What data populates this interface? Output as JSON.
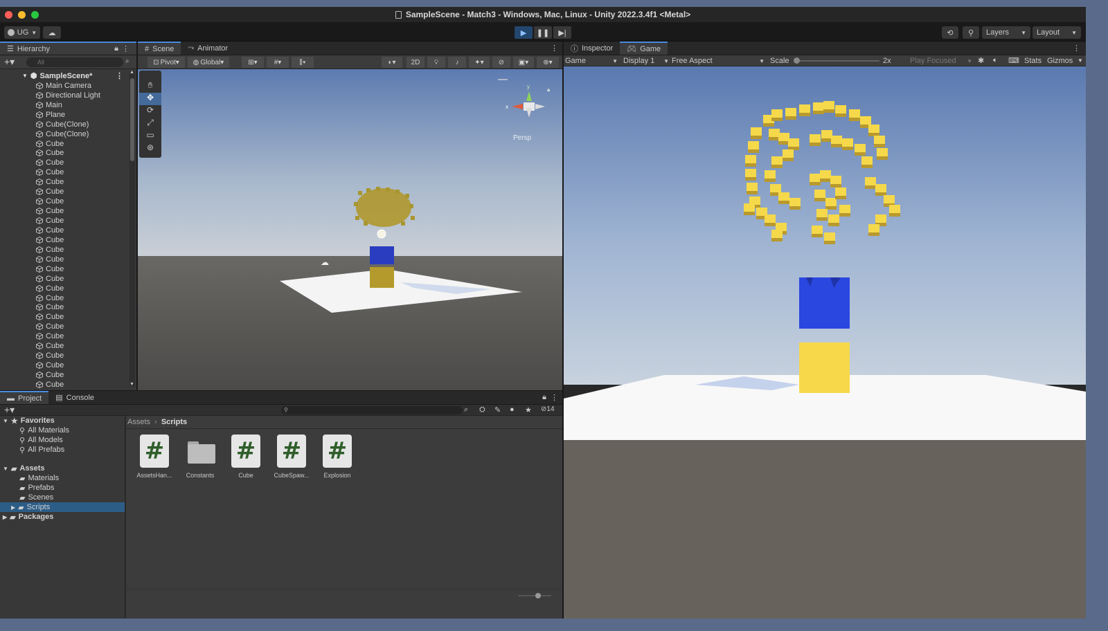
{
  "window": {
    "title": "SampleScene - Match3 - Windows, Mac, Linux - Unity 2022.3.4f1 <Metal>",
    "traffic_colors": [
      "#ff5f57",
      "#febc2e",
      "#28c840"
    ]
  },
  "toolbar": {
    "account_label": "UG",
    "layers_label": "Layers",
    "layout_label": "Layout",
    "play_active_color": "#4a8be0"
  },
  "hierarchy": {
    "tab_label": "Hierarchy",
    "search_placeholder": "All",
    "scene_name": "SampleScene*",
    "items": [
      "Main Camera",
      "Directional Light",
      "Main",
      "Plane",
      "Cube(Clone)",
      "Cube(Clone)",
      "Cube",
      "Cube",
      "Cube",
      "Cube",
      "Cube",
      "Cube",
      "Cube",
      "Cube",
      "Cube",
      "Cube",
      "Cube",
      "Cube",
      "Cube",
      "Cube",
      "Cube",
      "Cube",
      "Cube",
      "Cube",
      "Cube",
      "Cube",
      "Cube",
      "Cube",
      "Cube",
      "Cube",
      "Cube",
      "Cube"
    ]
  },
  "scene": {
    "tabs": [
      "Scene",
      "Animator"
    ],
    "pivot_label": "Pivot",
    "global_label": "Global",
    "mode_2d_label": "2D",
    "persp_label": "Persp",
    "gizmo_x_label": "x",
    "gizmo_y_label": "y"
  },
  "game": {
    "tabs": [
      "Inspector",
      "Game"
    ],
    "game_select": "Game",
    "display_select": "Display 1",
    "aspect_select": "Free Aspect",
    "scale_label": "Scale",
    "scale_value": "2x",
    "play_focused": "Play Focused",
    "stats_label": "Stats",
    "gizmos_label": "Gizmos"
  },
  "project": {
    "tabs": [
      "Project",
      "Console"
    ],
    "hidden_count": "14",
    "favorites_label": "Favorites",
    "favorites": [
      "All Materials",
      "All Models",
      "All Prefabs"
    ],
    "assets_label": "Assets",
    "asset_folders": [
      "Materials",
      "Prefabs",
      "Scenes",
      "Scripts"
    ],
    "packages_label": "Packages",
    "breadcrumb": [
      "Assets",
      "Scripts"
    ],
    "files": [
      {
        "name": "AssetsHan...",
        "kind": "script"
      },
      {
        "name": "Constants",
        "kind": "folder"
      },
      {
        "name": "Cube",
        "kind": "script"
      },
      {
        "name": "CubeSpaw...",
        "kind": "script"
      },
      {
        "name": "Explosion",
        "kind": "script"
      }
    ]
  }
}
